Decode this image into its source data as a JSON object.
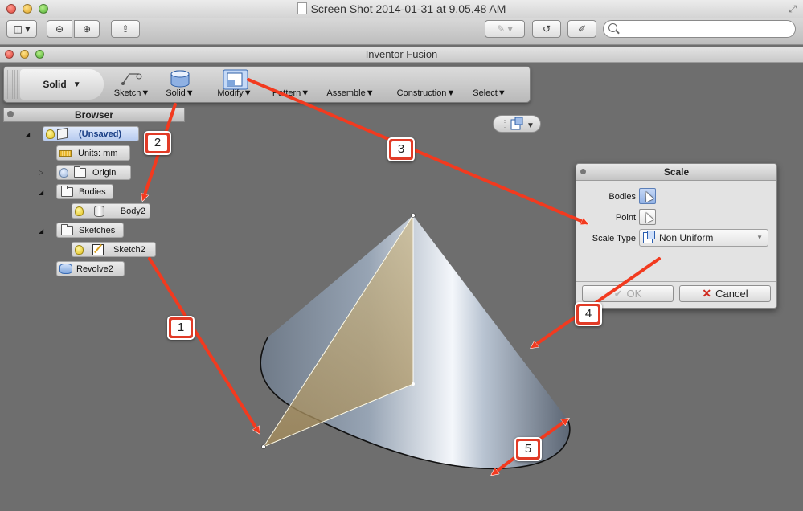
{
  "preview": {
    "title": "Screen Shot 2014-01-31 at 9.05.48 AM",
    "search_placeholder": ""
  },
  "window": {
    "title": "Inventor Fusion"
  },
  "ribbon": {
    "workspace": "Solid",
    "items": [
      {
        "label": "Sketch",
        "icon": "sketch-tool-icon"
      },
      {
        "label": "Solid",
        "icon": "solid-cylinder-icon"
      },
      {
        "label": "Modify",
        "icon": "modify-scale-icon"
      },
      {
        "label": "Pattern",
        "icon": ""
      },
      {
        "label": "Assemble",
        "icon": ""
      },
      {
        "label": "Construction",
        "icon": ""
      },
      {
        "label": "Select",
        "icon": ""
      }
    ]
  },
  "browser": {
    "title": "Browser",
    "nodes": [
      {
        "label": "(Unsaved)",
        "icon": "cube-icon"
      },
      {
        "label": "Units: mm",
        "icon": "ruler-icon"
      },
      {
        "label": "Origin",
        "icon": "folder-icon"
      },
      {
        "label": "Bodies",
        "icon": "folder-icon"
      },
      {
        "label": "Body2",
        "icon": "cylinder-icon"
      },
      {
        "label": "Sketches",
        "icon": "folder-icon"
      },
      {
        "label": "Sketch2",
        "icon": "sketch-icon"
      },
      {
        "label": "Revolve2",
        "icon": "revolve-icon"
      }
    ]
  },
  "dialog": {
    "title": "Scale",
    "bodies_label": "Bodies",
    "point_label": "Point",
    "scale_type_label": "Scale Type",
    "scale_type_value": "Non Uniform",
    "ok_label": "OK",
    "cancel_label": "Cancel"
  },
  "callouts": [
    "1",
    "2",
    "3",
    "4",
    "5"
  ],
  "colors": {
    "callout": "#e13b27",
    "arrow": "#f23a1f",
    "canvas": "#6e6e6e",
    "selected_node": "#b7cbef"
  }
}
